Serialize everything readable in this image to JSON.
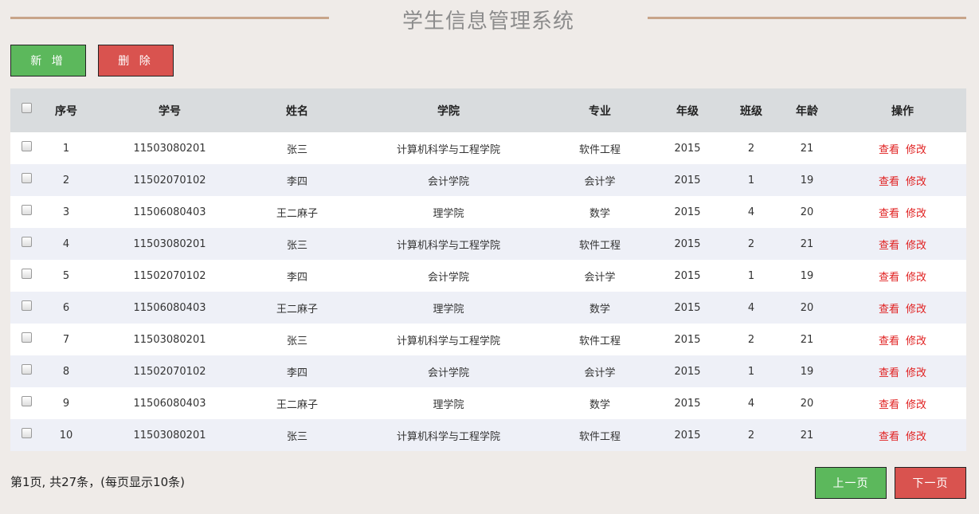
{
  "title": "学生信息管理系统",
  "toolbar": {
    "add_label": "新 增",
    "delete_label": "删 除"
  },
  "table": {
    "headers": [
      "序号",
      "学号",
      "姓名",
      "学院",
      "专业",
      "年级",
      "班级",
      "年龄",
      "操作"
    ],
    "rows": [
      {
        "no": "1",
        "id": "11503080201",
        "name": "张三",
        "college": "计算机科学与工程学院",
        "major": "软件工程",
        "grade": "2015",
        "class": "2",
        "age": "21",
        "view": "查看",
        "edit": "修改"
      },
      {
        "no": "2",
        "id": "11502070102",
        "name": "李四",
        "college": "会计学院",
        "major": "会计学",
        "grade": "2015",
        "class": "1",
        "age": "19",
        "view": "查看",
        "edit": "修改"
      },
      {
        "no": "3",
        "id": "11506080403",
        "name": "王二麻子",
        "college": "理学院",
        "major": "数学",
        "grade": "2015",
        "class": "4",
        "age": "20",
        "view": "查看",
        "edit": "修改"
      },
      {
        "no": "4",
        "id": "11503080201",
        "name": "张三",
        "college": "计算机科学与工程学院",
        "major": "软件工程",
        "grade": "2015",
        "class": "2",
        "age": "21",
        "view": "查看",
        "edit": "修改"
      },
      {
        "no": "5",
        "id": "11502070102",
        "name": "李四",
        "college": "会计学院",
        "major": "会计学",
        "grade": "2015",
        "class": "1",
        "age": "19",
        "view": "查看",
        "edit": "修改"
      },
      {
        "no": "6",
        "id": "11506080403",
        "name": "王二麻子",
        "college": "理学院",
        "major": "数学",
        "grade": "2015",
        "class": "4",
        "age": "20",
        "view": "查看",
        "edit": "修改"
      },
      {
        "no": "7",
        "id": "11503080201",
        "name": "张三",
        "college": "计算机科学与工程学院",
        "major": "软件工程",
        "grade": "2015",
        "class": "2",
        "age": "21",
        "view": "查看",
        "edit": "修改"
      },
      {
        "no": "8",
        "id": "11502070102",
        "name": "李四",
        "college": "会计学院",
        "major": "会计学",
        "grade": "2015",
        "class": "1",
        "age": "19",
        "view": "查看",
        "edit": "修改"
      },
      {
        "no": "9",
        "id": "11506080403",
        "name": "王二麻子",
        "college": "理学院",
        "major": "数学",
        "grade": "2015",
        "class": "4",
        "age": "20",
        "view": "查看",
        "edit": "修改"
      },
      {
        "no": "10",
        "id": "11503080201",
        "name": "张三",
        "college": "计算机科学与工程学院",
        "major": "软件工程",
        "grade": "2015",
        "class": "2",
        "age": "21",
        "view": "查看",
        "edit": "修改"
      }
    ]
  },
  "pagination": {
    "summary": "第1页, 共27条，(每页显示10条)",
    "prev_label": "上一页",
    "next_label": "下一页"
  },
  "colors": {
    "accent_line": "#c8a489",
    "add": "#5cb85c",
    "delete": "#d9534f",
    "link": "#e02020"
  }
}
